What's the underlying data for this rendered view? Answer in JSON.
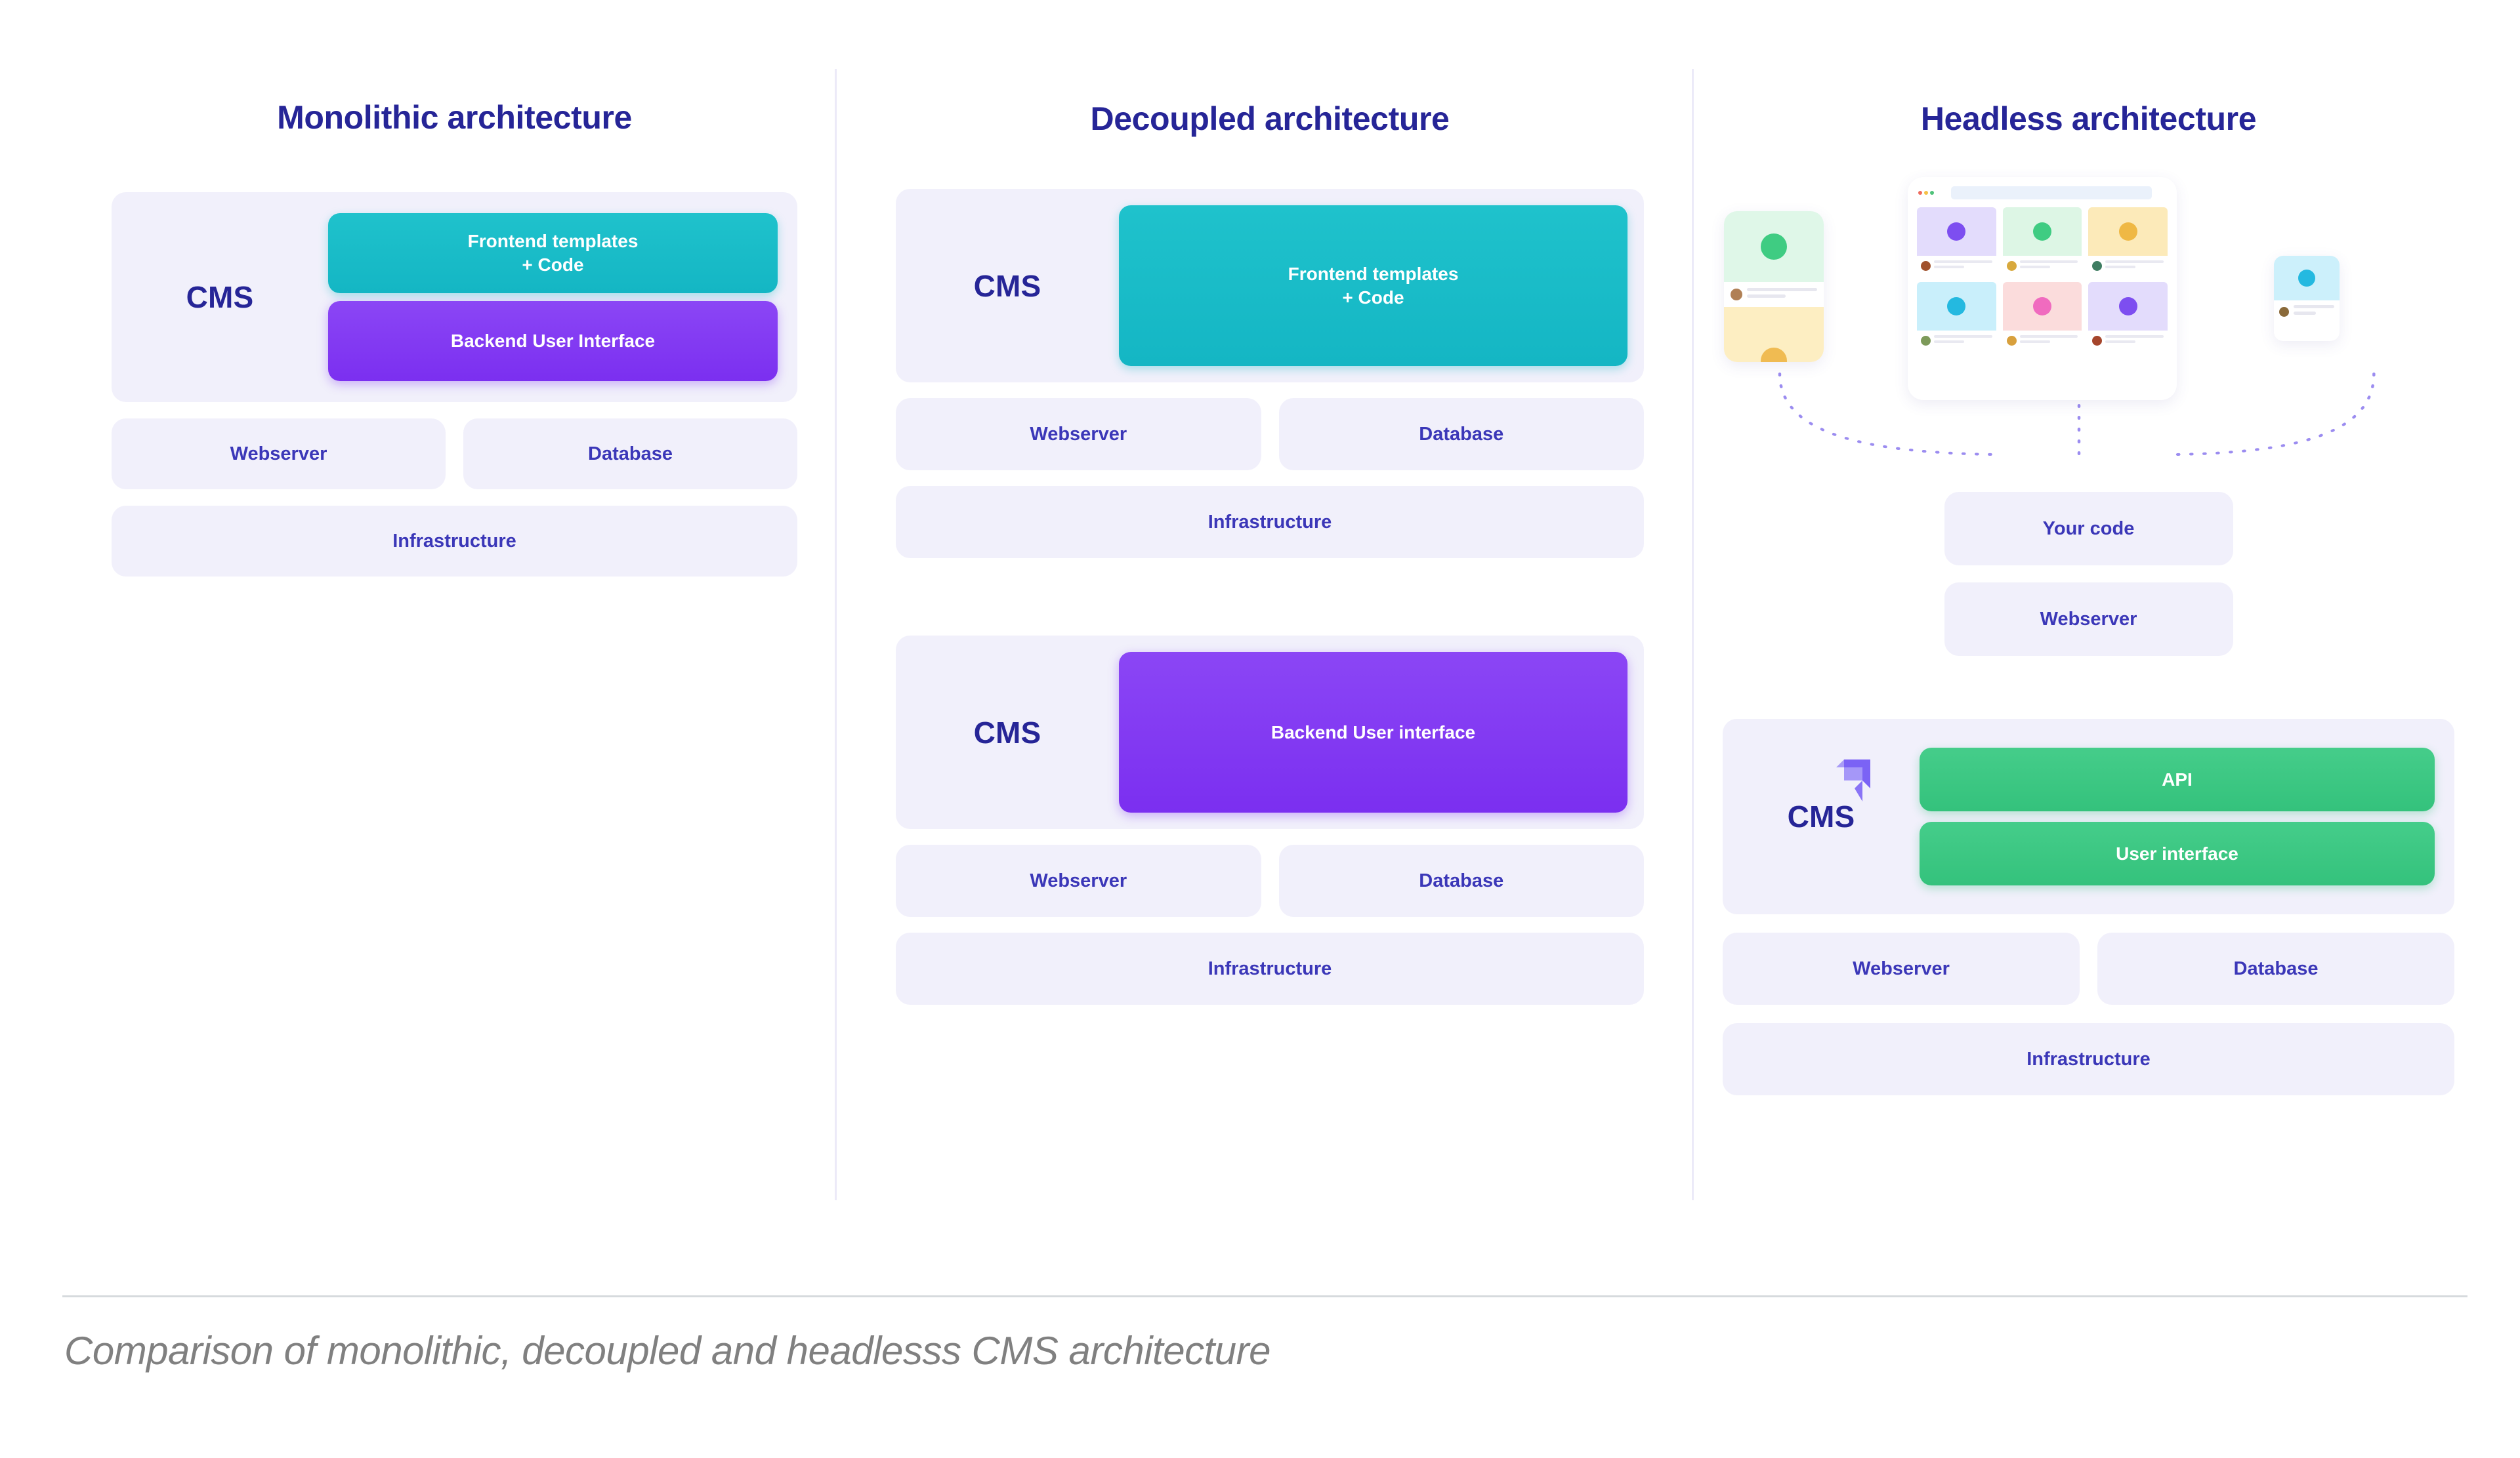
{
  "caption": "Comparison of monolithic, decoupled and headlesss CMS architecture",
  "colors": {
    "title_blue": "#262597",
    "label_blue": "#3b37b8",
    "panel_bg": "#f1f0fb",
    "teal": "#1fc2cc",
    "purple": "#7b2ff0",
    "green": "#34c27c",
    "divider": "#eceaf8",
    "caption_gray": "#808080"
  },
  "columns": [
    {
      "title": "Monolithic architecture",
      "cms_label": "CMS",
      "chips": [
        {
          "label": "Frontend templates\n+ Code",
          "line1": "Frontend templates",
          "line2": "+ Code",
          "color": "teal"
        },
        {
          "label": "Backend User Interface",
          "color": "purple"
        }
      ],
      "stack": {
        "webserver": "Webserver",
        "database": "Database",
        "infrastructure": "Infrastructure"
      }
    },
    {
      "title": "Decoupled architecture",
      "group_one": {
        "cms_label": "CMS",
        "chip": {
          "line1": "Frontend templates",
          "line2": "+ Code",
          "color": "teal"
        },
        "webserver": "Webserver",
        "database": "Database",
        "infrastructure": "Infrastructure"
      },
      "group_two": {
        "cms_label": "CMS",
        "chip": {
          "label": "Backend User interface",
          "color": "purple"
        },
        "webserver": "Webserver",
        "database": "Database",
        "infrastructure": "Infrastructure"
      }
    },
    {
      "title": "Headless architecture",
      "your_code": "Your code",
      "webserver_top": "Webserver",
      "cms_label": "CMS",
      "chips": [
        {
          "label": "API",
          "color": "green"
        },
        {
          "label": "User interface",
          "color": "green"
        }
      ],
      "stack": {
        "webserver": "Webserver",
        "database": "Database",
        "infrastructure": "Infrastructure"
      },
      "devices": [
        {
          "name": "phone-left",
          "media_colors": [
            "green",
            "yellow"
          ]
        },
        {
          "name": "tablet",
          "tile_colors": [
            "purple",
            "green",
            "yellow",
            "blue",
            "pink",
            "purple"
          ]
        },
        {
          "name": "phone-right",
          "media_colors": [
            "blue"
          ]
        }
      ]
    }
  ]
}
